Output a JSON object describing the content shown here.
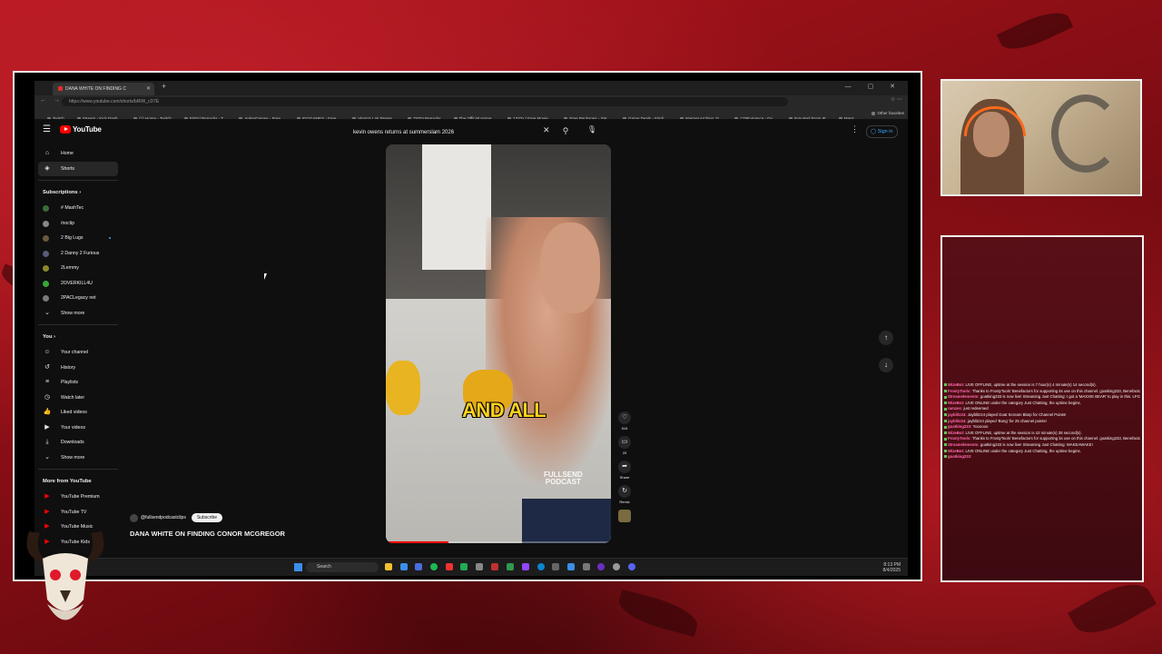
{
  "browser": {
    "tab_title": "DANA WHITE ON FINDING C",
    "url": "https://www.youtube.com/shorts/bRlW_cD7E",
    "bookmarks": [
      "Twitch",
      "Stream - Kick Dash...",
      "(1) Home - Twitch",
      "FitGirl Repacks - T...",
      "AnkerGames - Free...",
      "IGGGAMES - Free...",
      "Vimm's Lair Preser...",
      "DODI Repacks",
      "The Official Home...",
      "1337x | Free Movie...",
      "Free Packages - Ste...",
      "Game Deals - Findi...",
      "Internet Archive: D...",
      "CDRomance - Do...",
      "Imported From IE",
      "Maps"
    ],
    "bookmarks_right": "Other favorites"
  },
  "youtube": {
    "logo_text": "YouTube",
    "search_value": "kevin owens returns at summerslam 2026",
    "signin_label": "Sign in"
  },
  "sidebar": {
    "main": [
      {
        "label": "Home",
        "icon": "home-icon"
      },
      {
        "label": "Shorts",
        "icon": "shorts-icon"
      }
    ],
    "subscriptions_heading": "Subscriptions",
    "subscriptions": [
      {
        "label": "# MashTec",
        "color": "#3a6b3a"
      },
      {
        "label": "/noclip",
        "color": "#888888"
      },
      {
        "label": "2 Big Lugs",
        "color": "#6a5a3a"
      },
      {
        "label": "2 Danny 2 Furious",
        "color": "#5a5a7a"
      },
      {
        "label": "2Lemmy",
        "color": "#8a8a2a"
      },
      {
        "label": "2OVERKILL4U",
        "color": "#3aa53a"
      },
      {
        "label": "2PACLegacy net",
        "color": "#7a7a7a"
      }
    ],
    "show_more": "Show more",
    "you_heading": "You",
    "you_items": [
      {
        "label": "Your channel",
        "icon": "channel-icon"
      },
      {
        "label": "History",
        "icon": "history-icon"
      },
      {
        "label": "Playlists",
        "icon": "playlists-icon"
      },
      {
        "label": "Watch later",
        "icon": "watch-later-icon"
      },
      {
        "label": "Liked videos",
        "icon": "like-icon"
      },
      {
        "label": "Your videos",
        "icon": "your-videos-icon"
      },
      {
        "label": "Downloads",
        "icon": "download-icon"
      }
    ],
    "show_more_2": "Show more",
    "more_heading": "More from YouTube",
    "more_items": [
      "YouTube Premium",
      "YouTube TV",
      "YouTube Music",
      "YouTube Kids"
    ]
  },
  "short": {
    "caption": "AND ALL",
    "watermark_line1": "FULLSEND",
    "watermark_line2": "PODCAST",
    "progress": 0.28,
    "channel": "@fullsendpodcastclips",
    "subscribe_label": "Subscribe",
    "title": "DANA WHITE ON FINDING CONOR MCGREGOR",
    "like_count": "515",
    "comment_count": "20",
    "share_label": "Share",
    "remix_label": "Remix"
  },
  "taskbar": {
    "search_label": "Search",
    "time": "8:13 PM",
    "date": "8/4/2025"
  },
  "chat": [
    {
      "user": "WizeBot:",
      "text": "LIVE OFFLINE, uptime at the session is 7 hour(s) 4 minute(s) 14 second(s)."
    },
    {
      "user": "FrostyTools:",
      "text": "Thanks to FrostyTools' Benefactors for supporting its use on this channel. goatking233, Benefactor options (including skipping this notice and extra customization) are in the FrostyTools dashboard."
    },
    {
      "user": "Streamelements:",
      "text": "goatking233 is now live! Streaming Just Chatting: I got a 'MAXXIE BEAR' to play in this. LFGO"
    },
    {
      "user": "WizeBot:",
      "text": "LIVE ONLINE under the category Just Chatting, the uptime begins."
    },
    {
      "user": "ramzes:",
      "text": "just redeemed"
    },
    {
      "user": "jayblitz24:",
      "text": "Jayblitz24 played Goat Scream Blarp for Channel Points!"
    },
    {
      "user": "jayblitz24:",
      "text": "jayblitz24 played 'Bong' for 25 channel points!"
    },
    {
      "user": "goatking233:",
      "text": "Yoooooo"
    },
    {
      "user": "WizeBot:",
      "text": "LIVE OFFLINE, uptime at the session is 42 minute(s) 28 second(s)."
    },
    {
      "user": "FrostyTools:",
      "text": "Thanks to FrostyTools' Benefactors for supporting its use on this channel. goatking233, Benefactor options (including skipping this notice and extra customization) are in the FrostyTools dashboard."
    },
    {
      "user": "Streamelements:",
      "text": "goatking233 is now live! Streaming Just Chatting: WAKEAWAKE!"
    },
    {
      "user": "WizeBot:",
      "text": "LIVE ONLINE under the category Just Chatting, the uptime begins."
    },
    {
      "user": "goatking233:",
      "text": ""
    }
  ]
}
